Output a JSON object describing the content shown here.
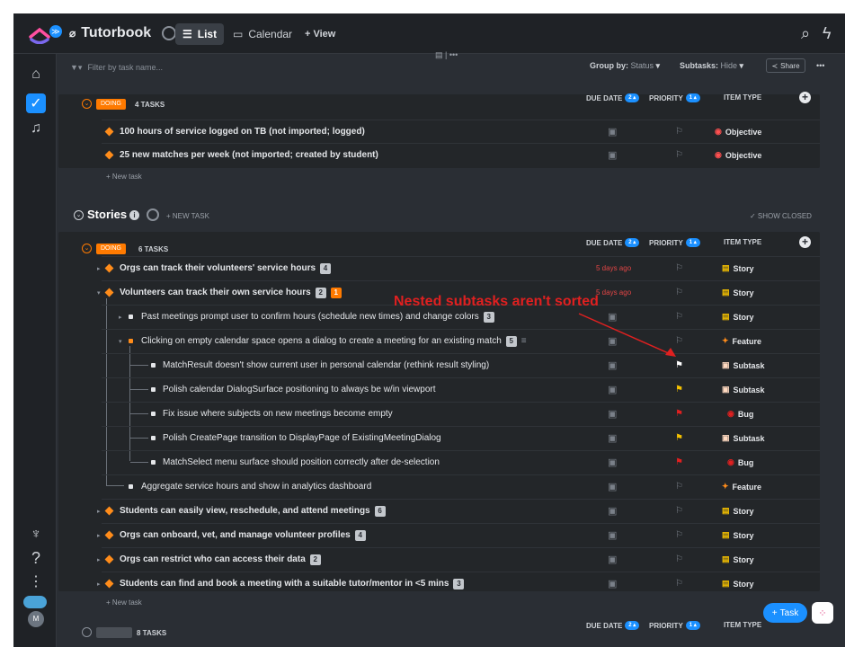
{
  "app": {
    "workspace_badge": "≫",
    "title": "Tutorbook"
  },
  "tabs": [
    {
      "label": "List",
      "active": true
    },
    {
      "label": "Calendar",
      "active": false
    },
    {
      "label": "+ View",
      "active": false
    }
  ],
  "filter": {
    "placeholder": "Filter by task name..."
  },
  "toolbar": {
    "group_by_label": "Group by:",
    "group_by_value": "Status",
    "subtasks_label": "Subtasks:",
    "subtasks_value": "Hide",
    "share_label": "Share",
    "more": "•••"
  },
  "columns": {
    "due_date": "DUE DATE",
    "priority": "PRIORITY",
    "item_type": "ITEM TYPE"
  },
  "top_group": {
    "status": "DOING",
    "count": "4 TASKS",
    "rows": [
      {
        "name": "100 hours of service logged on TB (not imported; logged)",
        "type": "Objective"
      },
      {
        "name": "25 new matches per week (not imported; created by student)",
        "type": "Objective"
      }
    ],
    "new_task": "+ New task"
  },
  "stories": {
    "title": "Stories",
    "new_task": "+ NEW TASK",
    "show_closed": "✓ SHOW CLOSED",
    "status": "DOING",
    "count": "6 TASKS",
    "rows": [
      {
        "name": "Orgs can track their volunteers' service hours",
        "badge": "4",
        "due": "5 days ago",
        "type": "Story"
      },
      {
        "name": "Volunteers can track their own service hours",
        "badge": "2",
        "badge2": "1",
        "due": "5 days ago",
        "type": "Story"
      },
      {
        "name": "Past meetings prompt user to confirm hours (schedule new times) and change colors",
        "badge": "3",
        "type": "Story"
      },
      {
        "name": "Clicking on empty calendar space opens a dialog to create a meeting for an existing match",
        "badge": "5",
        "type": "Feature"
      },
      {
        "name": "MatchResult doesn't show current user in personal calendar (rethink result styling)",
        "type": "Subtask"
      },
      {
        "name": "Polish calendar DialogSurface positioning to always be w/in viewport",
        "type": "Subtask"
      },
      {
        "name": "Fix issue where subjects on new meetings become empty",
        "type": "Bug"
      },
      {
        "name": "Polish CreatePage transition to DisplayPage of ExistingMeetingDialog",
        "type": "Subtask"
      },
      {
        "name": "MatchSelect menu surface should position correctly after de-selection",
        "type": "Bug"
      },
      {
        "name": "Aggregate service hours and show in analytics dashboard",
        "type": "Feature"
      },
      {
        "name": "Students can easily view, reschedule, and attend meetings",
        "badge": "6",
        "type": "Story"
      },
      {
        "name": "Orgs can onboard, vet, and manage volunteer profiles",
        "badge": "4",
        "type": "Story"
      },
      {
        "name": "Orgs can restrict who can access their data",
        "badge": "2",
        "type": "Story"
      },
      {
        "name": "Students can find and book a meeting with a suitable tutor/mentor in <5 mins",
        "badge": "3",
        "type": "Story"
      }
    ],
    "new_task2": "+ New task"
  },
  "bottom_group": {
    "count": "8 TASKS"
  },
  "annotation": "Nested subtasks aren't sorted",
  "fab": {
    "task_label": "Task"
  },
  "avatar": "M"
}
